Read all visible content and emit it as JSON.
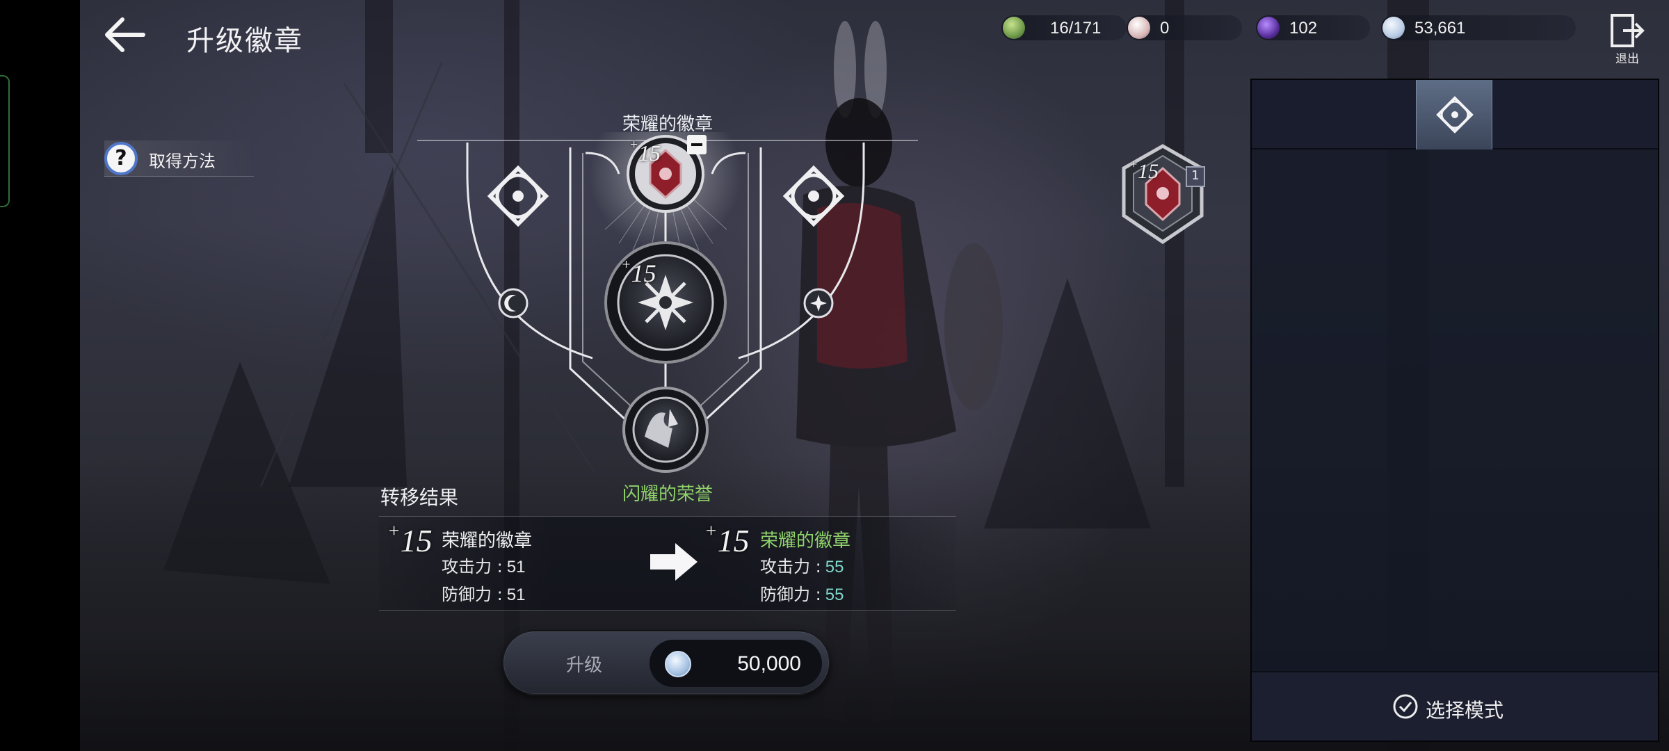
{
  "header": {
    "title": "升级徽章",
    "exit_label": "退出"
  },
  "currencies": [
    {
      "icon": "green-gem-icon",
      "value": "16/171",
      "color": "#6f9a4a"
    },
    {
      "icon": "pearl-icon",
      "value": "0",
      "color": "#d8b8b8"
    },
    {
      "icon": "purple-orb-icon",
      "value": "102",
      "color": "#5a2f9e"
    },
    {
      "icon": "silver-coin-icon",
      "value": "53,661",
      "color": "#b9cbe3"
    }
  ],
  "obtain_method": {
    "label": "取得方法"
  },
  "badge_frame": {
    "title": "荣耀的徽章",
    "top_badge_level": "15",
    "center_badge_level": "15",
    "bottom_badge_name": "闪耀的荣誉"
  },
  "transfer_result": {
    "title": "转移结果",
    "before": {
      "level": "15",
      "name": "荣耀的徽章",
      "atk_label": "攻击力 :",
      "atk": "51",
      "def_label": "防御力 :",
      "def": "51"
    },
    "after": {
      "level": "15",
      "name": "荣耀的徽章",
      "atk_label": "攻击力 :",
      "atk": "55",
      "def_label": "防御力 :",
      "def": "55"
    }
  },
  "upgrade": {
    "label": "升级",
    "cost": "50,000"
  },
  "equipped_badge": {
    "level": "15",
    "count": "1"
  },
  "inventory": {
    "select_mode_label": "选择模式"
  },
  "colors": {
    "accent_green": "#8fd36a",
    "stat_up": "#7fd6c9",
    "panel_bg": "#141826"
  }
}
